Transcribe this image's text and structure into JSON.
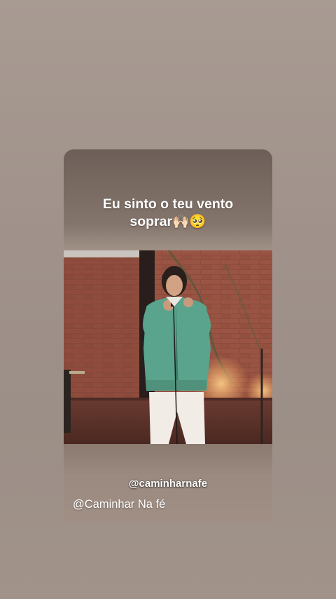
{
  "post": {
    "caption_line1": "Eu sinto o teu vento",
    "caption_line2": "soprar",
    "caption_emoji": "🙌🏻🥺",
    "video_handle": "@caminharnafe",
    "channel_handle": "@Caminhar Na fé"
  },
  "colors": {
    "background": "#a0928a",
    "caption_text": "#ffffff",
    "jacket": "#5aa38c",
    "brick": "#8f4a3c"
  }
}
